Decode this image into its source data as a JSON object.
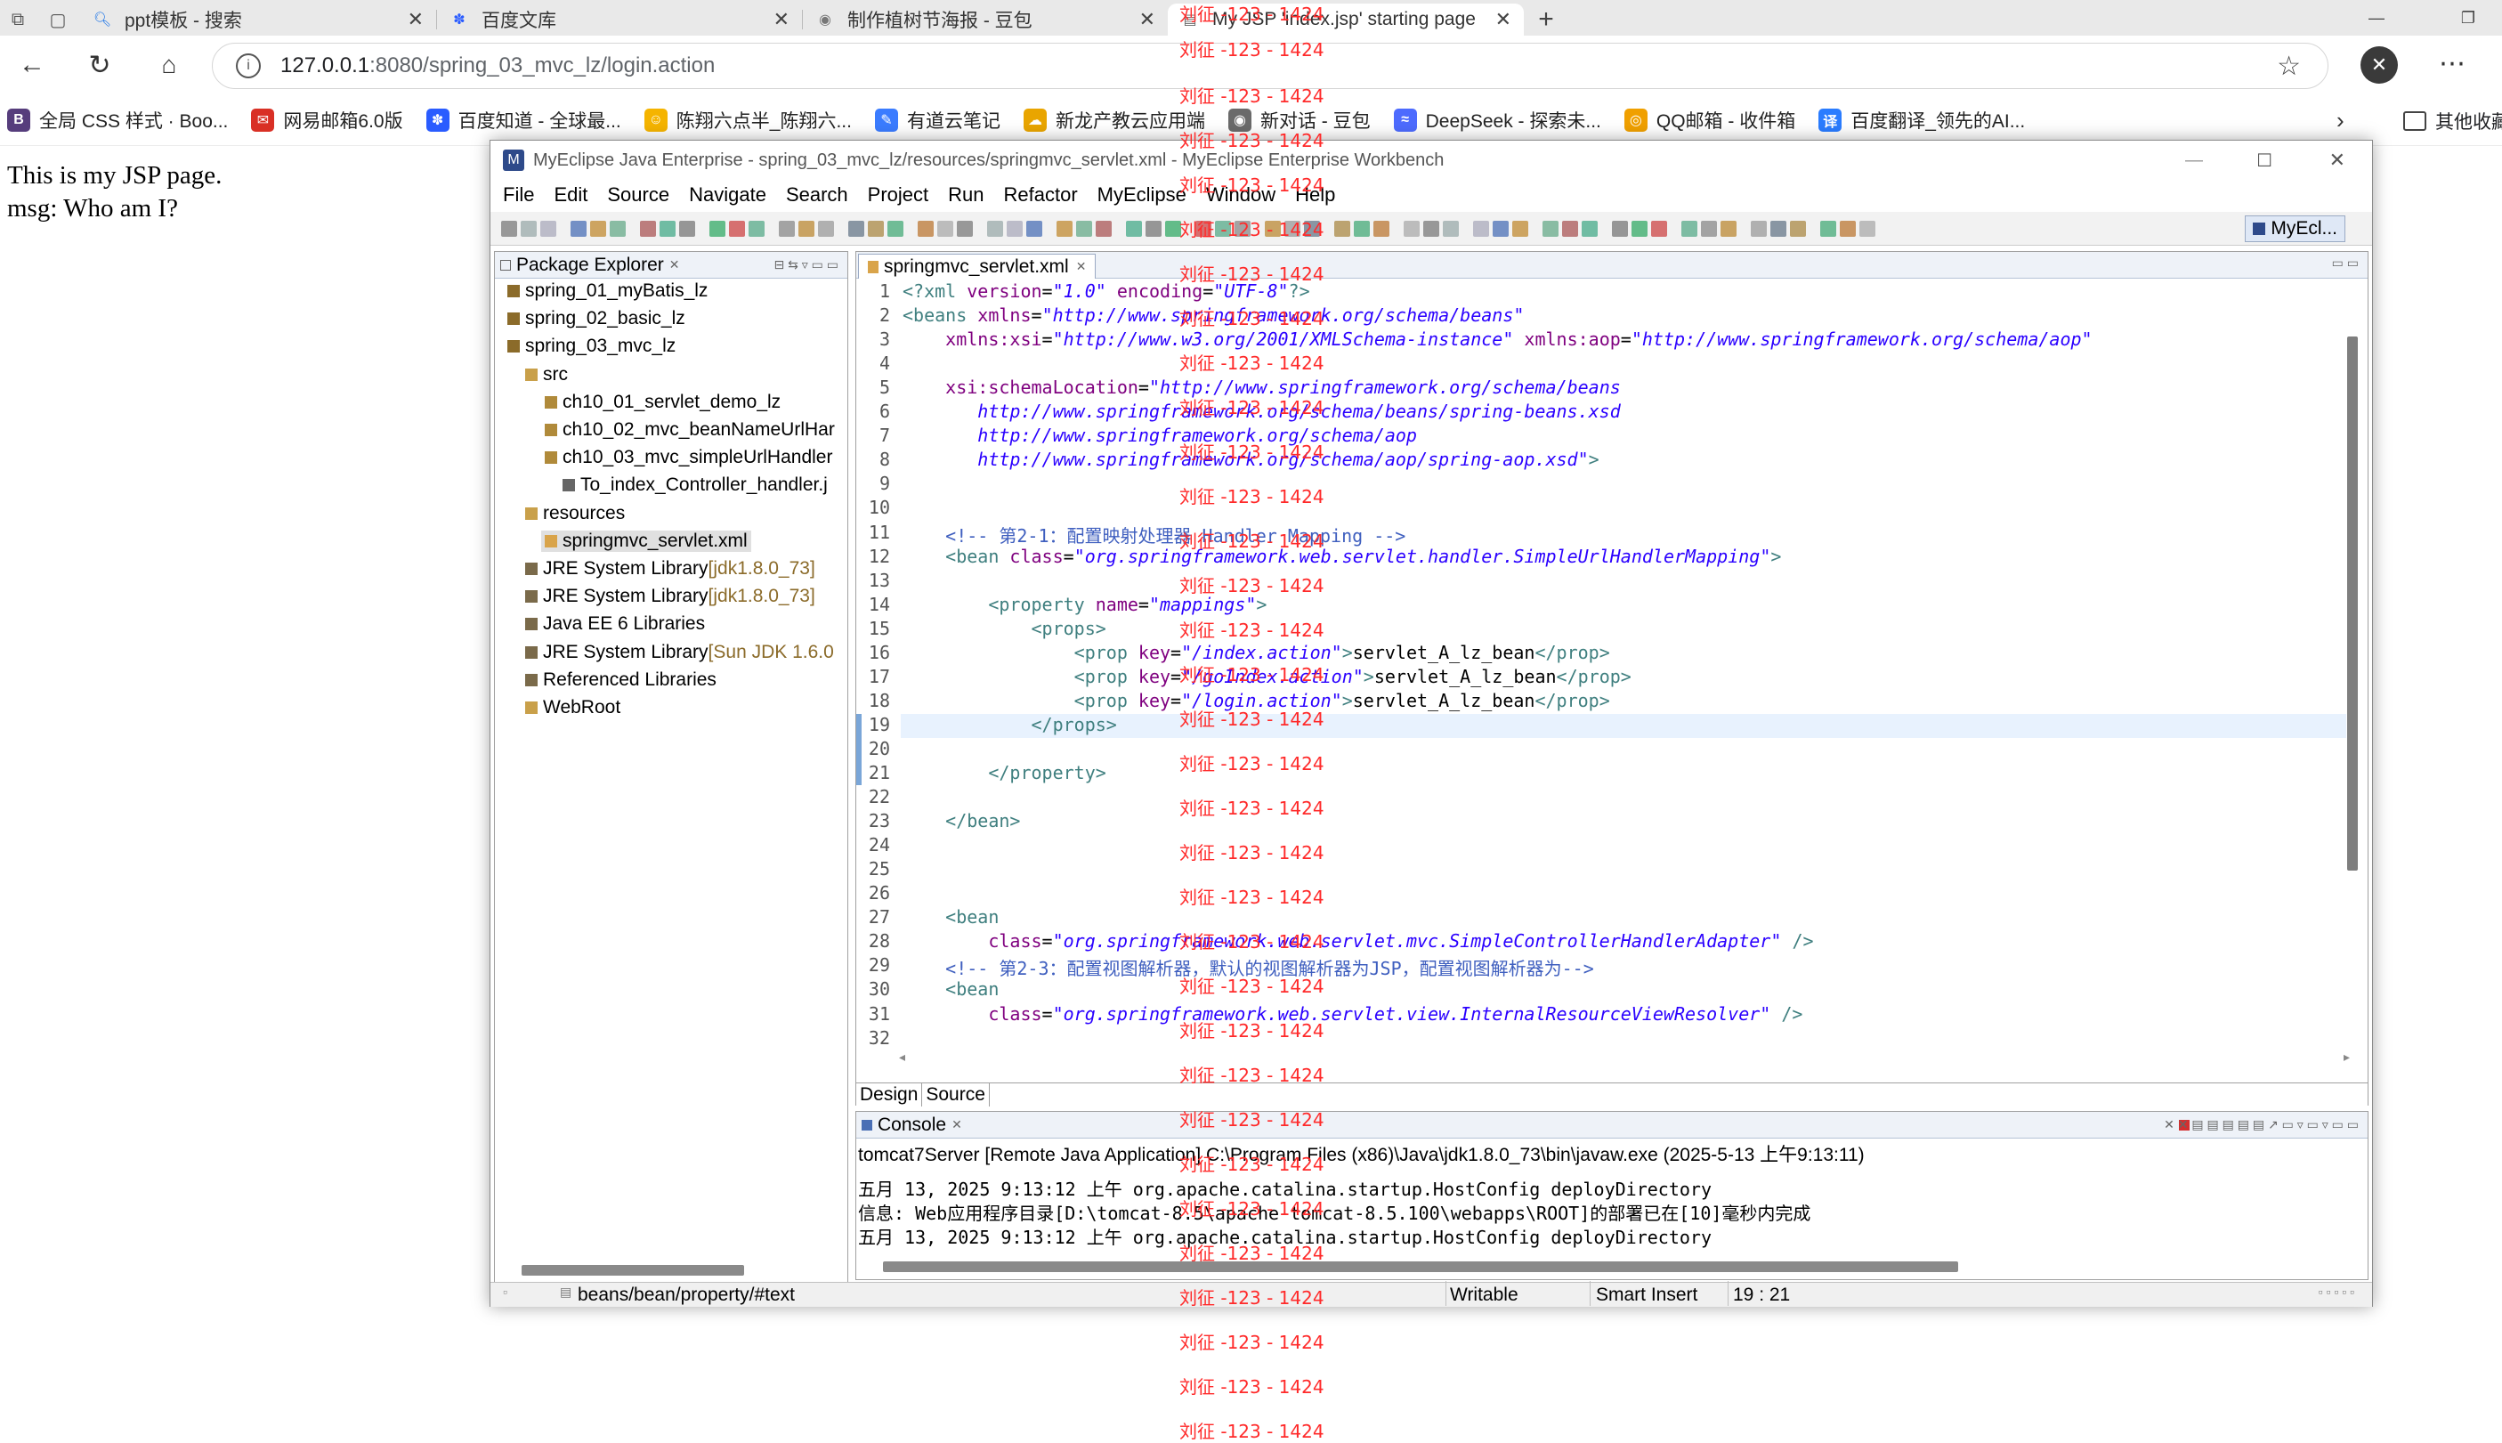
{
  "browser": {
    "tabs": [
      {
        "label": "ppt模板 - 搜索",
        "icon": "search-icon"
      },
      {
        "label": "百度文库",
        "icon": "baidu-paw-icon"
      },
      {
        "label": "制作植树节海报 - 豆包",
        "icon": "doubao-icon"
      },
      {
        "label": "My JSP 'index.jsp' starting page",
        "icon": "page-icon"
      }
    ],
    "new_tab": "+",
    "url_host": "127.0.0.1",
    "url_rest": ":8080/spring_03_mvc_lz/login.action",
    "bookmarks": [
      {
        "label": "全局 CSS 样式 · Boo...",
        "icon_color": "#563d7c",
        "glyph": "B"
      },
      {
        "label": "网易邮箱6.0版",
        "icon_color": "#d93025",
        "glyph": "✉"
      },
      {
        "label": "百度知道 - 全球最...",
        "icon_color": "#2a5cff",
        "glyph": "✽"
      },
      {
        "label": "陈翔六点半_陈翔六...",
        "icon_color": "#f5b400",
        "glyph": "☺"
      },
      {
        "label": "有道云笔记",
        "icon_color": "#3b7cff",
        "glyph": "✎"
      },
      {
        "label": "新龙产教云应用端",
        "icon_color": "#e9a500",
        "glyph": "☁"
      },
      {
        "label": "新对话 - 豆包",
        "icon_color": "#6a6a6a",
        "glyph": "◉"
      },
      {
        "label": "DeepSeek - 探索未...",
        "icon_color": "#4d6bfe",
        "glyph": "≈"
      },
      {
        "label": "QQ邮箱 - 收件箱",
        "icon_color": "#f0a000",
        "glyph": "◎"
      },
      {
        "label": "百度翻译_领先的AI...",
        "icon_color": "#2a7cff",
        "glyph": "译"
      }
    ],
    "bookmarks_more": "其他收藏夹"
  },
  "page": {
    "line1": "This is my JSP page.",
    "line2": "msg: Who am I?"
  },
  "ide": {
    "title": "MyEclipse Java Enterprise - spring_03_mvc_lz/resources/springmvc_servlet.xml - MyEclipse Enterprise Workbench",
    "menu": [
      "File",
      "Edit",
      "Source",
      "Navigate",
      "Search",
      "Project",
      "Run",
      "Refactor",
      "MyEclipse",
      "Window",
      "Help"
    ],
    "perspective": "MyEcl...",
    "package_explorer": {
      "title": "Package Explorer",
      "items": [
        {
          "label": "spring_01_myBatis_lz",
          "lib": ""
        },
        {
          "label": "spring_02_basic_lz",
          "lib": ""
        },
        {
          "label": "spring_03_mvc_lz",
          "lib": ""
        },
        {
          "label": "src",
          "lib": ""
        },
        {
          "label": "ch10_01_servlet_demo_lz",
          "lib": ""
        },
        {
          "label": "ch10_02_mvc_beanNameUrlHar",
          "lib": ""
        },
        {
          "label": "ch10_03_mvc_simpleUrlHandler",
          "lib": ""
        },
        {
          "label": "To_index_Controller_handler.j",
          "lib": ""
        },
        {
          "label": "resources",
          "lib": ""
        },
        {
          "label": "springmvc_servlet.xml",
          "lib": ""
        },
        {
          "label": "JRE System Library ",
          "lib": "[jdk1.8.0_73]"
        },
        {
          "label": "JRE System Library ",
          "lib": "[jdk1.8.0_73]"
        },
        {
          "label": "Java EE 6 Libraries",
          "lib": ""
        },
        {
          "label": "JRE System Library ",
          "lib": "[Sun JDK 1.6.0"
        },
        {
          "label": "Referenced Libraries",
          "lib": ""
        },
        {
          "label": "WebRoot",
          "lib": ""
        }
      ]
    },
    "editor": {
      "tab": "springmvc_servlet.xml",
      "bottom_tabs": [
        "Design",
        "Source"
      ],
      "lines": [
        [
          [
            "t-tag",
            "<?xml "
          ],
          [
            "t-attr",
            "version"
          ],
          [
            "t-txt",
            "="
          ],
          [
            "t-val",
            "\"1.0\""
          ],
          [
            "t-txt",
            " "
          ],
          [
            "t-attr",
            "encoding"
          ],
          [
            "t-txt",
            "="
          ],
          [
            "t-val",
            "\"UTF-8\""
          ],
          [
            "t-tag",
            "?>"
          ]
        ],
        [
          [
            "t-tag",
            "<beans "
          ],
          [
            "t-attr",
            "xmlns"
          ],
          [
            "t-txt",
            "="
          ],
          [
            "t-val",
            "\"http://www.springframework.org/schema/beans\""
          ]
        ],
        [
          [
            "t-txt",
            "    "
          ],
          [
            "t-attr",
            "xmlns:xsi"
          ],
          [
            "t-txt",
            "="
          ],
          [
            "t-val",
            "\"http://www.w3.org/2001/XMLSchema-instance\""
          ],
          [
            "t-txt",
            " "
          ],
          [
            "t-attr",
            "xmlns:aop"
          ],
          [
            "t-txt",
            "="
          ],
          [
            "t-val",
            "\"http://www.springframework.org/schema/aop\""
          ]
        ],
        [],
        [
          [
            "t-txt",
            "    "
          ],
          [
            "t-attr",
            "xsi:schemaLocation"
          ],
          [
            "t-txt",
            "="
          ],
          [
            "t-val",
            "\"http://www.springframework.org/schema/beans"
          ]
        ],
        [
          [
            "t-val",
            "       http://www.springframework.org/schema/beans/spring-beans.xsd"
          ]
        ],
        [
          [
            "t-val",
            "       http://www.springframework.org/schema/aop"
          ]
        ],
        [
          [
            "t-val",
            "       http://www.springframework.org/schema/aop/spring-aop.xsd\""
          ],
          [
            "t-tag",
            ">"
          ]
        ],
        [],
        [],
        [
          [
            "t-com",
            "    <!-- 第2-1：配置映射处理器 Handler Mapping -->"
          ]
        ],
        [
          [
            "t-txt",
            "    "
          ],
          [
            "t-tag",
            "<bean "
          ],
          [
            "t-attr",
            "class"
          ],
          [
            "t-txt",
            "="
          ],
          [
            "t-val",
            "\"org.springframework.web.servlet.handler.SimpleUrlHandlerMapping\""
          ],
          [
            "t-tag",
            ">"
          ]
        ],
        [],
        [
          [
            "t-txt",
            "        "
          ],
          [
            "t-tag",
            "<property "
          ],
          [
            "t-attr",
            "name"
          ],
          [
            "t-txt",
            "="
          ],
          [
            "t-val",
            "\"mappings\""
          ],
          [
            "t-tag",
            ">"
          ]
        ],
        [
          [
            "t-txt",
            "            "
          ],
          [
            "t-tag",
            "<props>"
          ]
        ],
        [
          [
            "t-txt",
            "                "
          ],
          [
            "t-tag",
            "<prop "
          ],
          [
            "t-attr",
            "key"
          ],
          [
            "t-txt",
            "="
          ],
          [
            "t-val",
            "\"/index.action\""
          ],
          [
            "t-tag",
            ">"
          ],
          [
            "t-txt",
            "servlet_A_lz_bean"
          ],
          [
            "t-tag",
            "</prop>"
          ]
        ],
        [
          [
            "t-txt",
            "                "
          ],
          [
            "t-tag",
            "<prop "
          ],
          [
            "t-attr",
            "key"
          ],
          [
            "t-txt",
            "="
          ],
          [
            "t-val",
            "\"/goIndex.action\""
          ],
          [
            "t-tag",
            ">"
          ],
          [
            "t-txt",
            "servlet_A_lz_bean"
          ],
          [
            "t-tag",
            "</prop>"
          ]
        ],
        [
          [
            "t-txt",
            "                "
          ],
          [
            "t-tag",
            "<prop "
          ],
          [
            "t-attr",
            "key"
          ],
          [
            "t-txt",
            "="
          ],
          [
            "t-val",
            "\"/login.action\""
          ],
          [
            "t-tag",
            ">"
          ],
          [
            "t-txt",
            "servlet_A_lz_bean"
          ],
          [
            "t-tag",
            "</prop>"
          ]
        ],
        [
          [
            "t-txt",
            "            "
          ],
          [
            "t-tag",
            "</props>"
          ]
        ],
        [],
        [
          [
            "t-txt",
            "        "
          ],
          [
            "t-tag",
            "</property>"
          ]
        ],
        [],
        [
          [
            "t-txt",
            "    "
          ],
          [
            "t-tag",
            "</bean>"
          ]
        ],
        [],
        [],
        [],
        [
          [
            "t-txt",
            "    "
          ],
          [
            "t-tag",
            "<bean"
          ]
        ],
        [
          [
            "t-txt",
            "        "
          ],
          [
            "t-attr",
            "class"
          ],
          [
            "t-txt",
            "="
          ],
          [
            "t-val",
            "\"org.springframework.web.servlet.mvc.SimpleControllerHandlerAdapter\""
          ],
          [
            "t-txt",
            " "
          ],
          [
            "t-tag",
            "/>"
          ]
        ],
        [
          [
            "t-com",
            "    <!-- 第2-3：配置视图解析器，默认的视图解析器为JSP，配置视图解析器为-->"
          ]
        ],
        [
          [
            "t-txt",
            "    "
          ],
          [
            "t-tag",
            "<bean"
          ]
        ],
        [
          [
            "t-txt",
            "        "
          ],
          [
            "t-attr",
            "class"
          ],
          [
            "t-txt",
            "="
          ],
          [
            "t-val",
            "\"org.springframework.web.servlet.view.InternalResourceViewResolver\""
          ],
          [
            "t-txt",
            " "
          ],
          [
            "t-tag",
            "/>"
          ]
        ],
        []
      ]
    },
    "console": {
      "title": "Console",
      "process": "tomcat7Server [Remote Java Application] C:\\Program Files (x86)\\Java\\jdk1.8.0_73\\bin\\javaw.exe (2025-5-13 上午9:13:11)",
      "lines": [
        "五月 13, 2025 9:13:12 上午 org.apache.catalina.startup.HostConfig deployDirectory",
        "信息: Web应用程序目录[D:\\tomcat-8.5\\apache-tomcat-8.5.100\\webapps\\ROOT]的部署已在[10]毫秒内完成",
        "五月 13, 2025 9:13:12 上午 org.apache.catalina.startup.HostConfig deployDirectory"
      ]
    },
    "status": {
      "path": "beans/bean/property/#text",
      "mode": "Writable",
      "insert": "Smart Insert",
      "position": "19 : 21"
    }
  },
  "watermark": "刘征 -123 - 1424"
}
